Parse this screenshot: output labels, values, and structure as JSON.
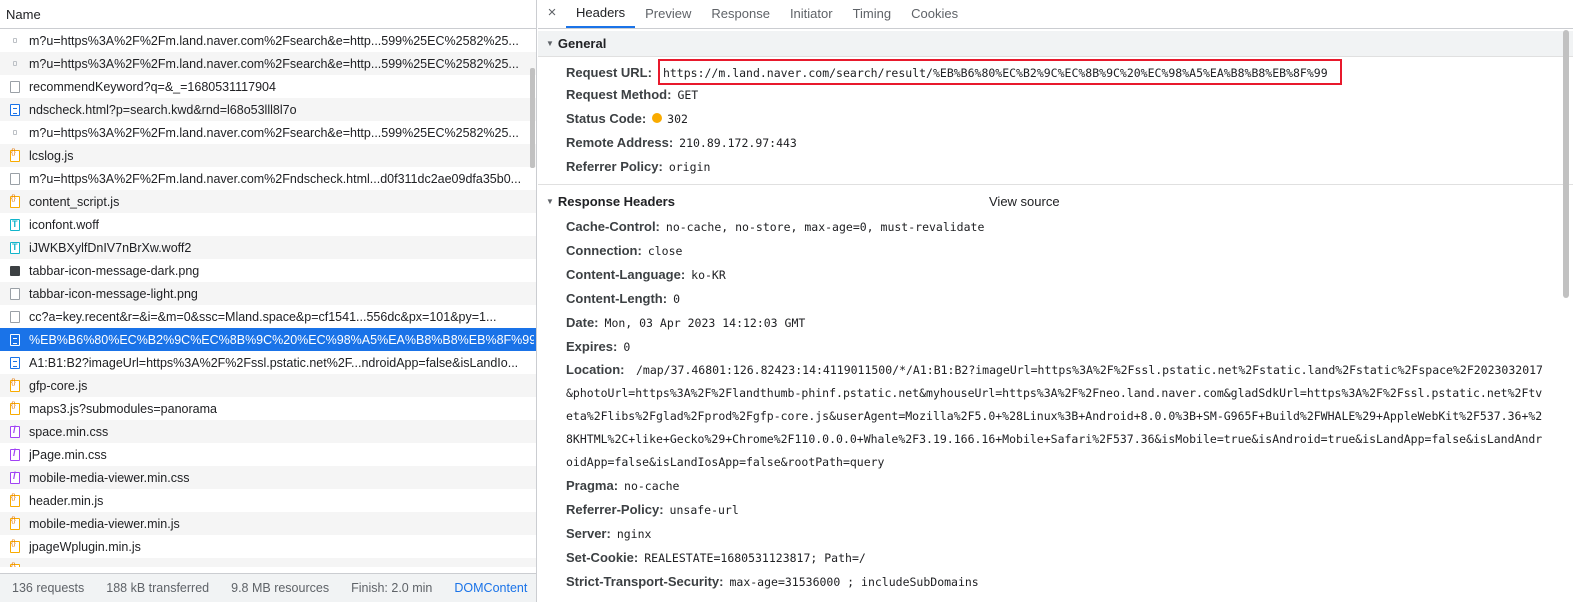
{
  "left": {
    "header": "Name",
    "rows": [
      {
        "icon": "tiny",
        "text": "m?u=https%3A%2F%2Fm.land.naver.com%2Fsearch&e=http...599%25EC%2582%25...",
        "selected": false
      },
      {
        "icon": "tiny",
        "text": "m?u=https%3A%2F%2Fm.land.naver.com%2Fsearch&e=http...599%25EC%2582%25...",
        "selected": false
      },
      {
        "icon": "blank",
        "text": "recommendKeyword?q=&_=1680531117904",
        "selected": false
      },
      {
        "icon": "doc",
        "text": "ndscheck.html?p=search.kwd&rnd=l68o53lll8l7o",
        "selected": false
      },
      {
        "icon": "tiny",
        "text": "m?u=https%3A%2F%2Fm.land.naver.com%2Fsearch&e=http...599%25EC%2582%25...",
        "selected": false
      },
      {
        "icon": "js",
        "text": "lcslog.js",
        "selected": false
      },
      {
        "icon": "blank",
        "text": "m?u=https%3A%2F%2Fm.land.naver.com%2Fndscheck.html...d0f311dc2ae09dfa35b0...",
        "selected": false
      },
      {
        "icon": "js",
        "text": "content_script.js",
        "selected": false
      },
      {
        "icon": "font",
        "text": "iconfont.woff",
        "selected": false
      },
      {
        "icon": "font",
        "text": "iJWKBXylfDnIV7nBrXw.woff2",
        "selected": false
      },
      {
        "icon": "imgdark",
        "text": "tabbar-icon-message-dark.png",
        "selected": false
      },
      {
        "icon": "blank",
        "text": "tabbar-icon-message-light.png",
        "selected": false
      },
      {
        "icon": "blank",
        "text": "cc?a=key.recent&r=&i=&m=0&ssc=Mland.space&p=cf1541...556dc&px=101&py=1...",
        "selected": false
      },
      {
        "icon": "doc",
        "text": "%EB%B6%80%EC%B2%9C%EC%8B%9C%20%EC%98%A5%EA%B8%B8%EB%8F%99",
        "selected": true
      },
      {
        "icon": "doc",
        "text": "A1:B1:B2?imageUrl=https%3A%2F%2Fssl.pstatic.net%2F...ndroidApp=false&isLandIo...",
        "selected": false
      },
      {
        "icon": "js",
        "text": "gfp-core.js",
        "selected": false
      },
      {
        "icon": "js",
        "text": "maps3.js?submodules=panorama",
        "selected": false
      },
      {
        "icon": "css",
        "text": "space.min.css",
        "selected": false
      },
      {
        "icon": "css",
        "text": "jPage.min.css",
        "selected": false
      },
      {
        "icon": "css",
        "text": "mobile-media-viewer.min.css",
        "selected": false
      },
      {
        "icon": "js",
        "text": "header.min.js",
        "selected": false
      },
      {
        "icon": "js",
        "text": "mobile-media-viewer.min.js",
        "selected": false
      },
      {
        "icon": "js",
        "text": "jpageWplugin.min.js",
        "selected": false
      },
      {
        "icon": "js",
        "text": "",
        "selected": false
      }
    ],
    "status": {
      "requests": "136 requests",
      "transferred": "188 kB transferred",
      "resources": "9.8 MB resources",
      "finish": "Finish: 2.0 min",
      "dom": "DOMContent"
    }
  },
  "right": {
    "close": "×",
    "tabs": [
      "Headers",
      "Preview",
      "Response",
      "Initiator",
      "Timing",
      "Cookies"
    ],
    "active_tab": "Headers",
    "general": {
      "title": "General",
      "request_url_label": "Request URL:",
      "request_url": "https://m.land.naver.com/search/result/%EB%B6%80%EC%B2%9C%EC%8B%9C%20%EC%98%A5%EA%B8%B8%EB%8F%99",
      "method_label": "Request Method:",
      "method": "GET",
      "status_label": "Status Code:",
      "status": "302",
      "remote_label": "Remote Address:",
      "remote": "210.89.172.97:443",
      "referrer_label": "Referrer Policy:",
      "referrer": "origin"
    },
    "response": {
      "title": "Response Headers",
      "view_source": "View source",
      "cache_control_label": "Cache-Control:",
      "cache_control": "no-cache, no-store, max-age=0, must-revalidate",
      "connection_label": "Connection:",
      "connection": "close",
      "content_language_label": "Content-Language:",
      "content_language": "ko-KR",
      "content_length_label": "Content-Length:",
      "content_length": "0",
      "date_label": "Date:",
      "date": "Mon, 03 Apr 2023 14:12:03 GMT",
      "expires_label": "Expires:",
      "expires": "0",
      "location_label": "Location:",
      "location": "/map/37.46801:126.82423:14:4119011500/*/A1:B1:B2?imageUrl=https%3A%2F%2Fssl.pstatic.net%2Fstatic.land%2Fstatic%2Fspace%2F2023032017&photoUrl=https%3A%2F%2Flandthumb-phinf.pstatic.net&myhouseUrl=https%3A%2F%2Fneo.land.naver.com&gladSdkUrl=https%3A%2F%2Fssl.pstatic.net%2Ftveta%2Flibs%2Fglad%2Fprod%2Fgfp-core.js&userAgent=Mozilla%2F5.0+%28Linux%3B+Android+8.0.0%3B+SM-G965F+Build%2FWHALE%29+AppleWebKit%2F537.36+%28KHTML%2C+like+Gecko%29+Chrome%2F110.0.0.0+Whale%2F3.19.166.16+Mobile+Safari%2F537.36&isMobile=true&isAndroid=true&isLandApp=false&isLandAndroidApp=false&isLandIosApp=false&rootPath=query",
      "pragma_label": "Pragma:",
      "pragma": "no-cache",
      "referrer_policy_label": "Referrer-Policy:",
      "referrer_policy": "unsafe-url",
      "server_label": "Server:",
      "server": "nginx",
      "set_cookie_label": "Set-Cookie:",
      "set_cookie": "REALESTATE=1680531123817; Path=/",
      "sts_label": "Strict-Transport-Security:",
      "sts": "max-age=31536000 ; includeSubDomains"
    }
  },
  "colors": {
    "selected_row": "#1a73e8",
    "highlight_box": "#e8192c",
    "status_dot": "#f9ab00"
  }
}
